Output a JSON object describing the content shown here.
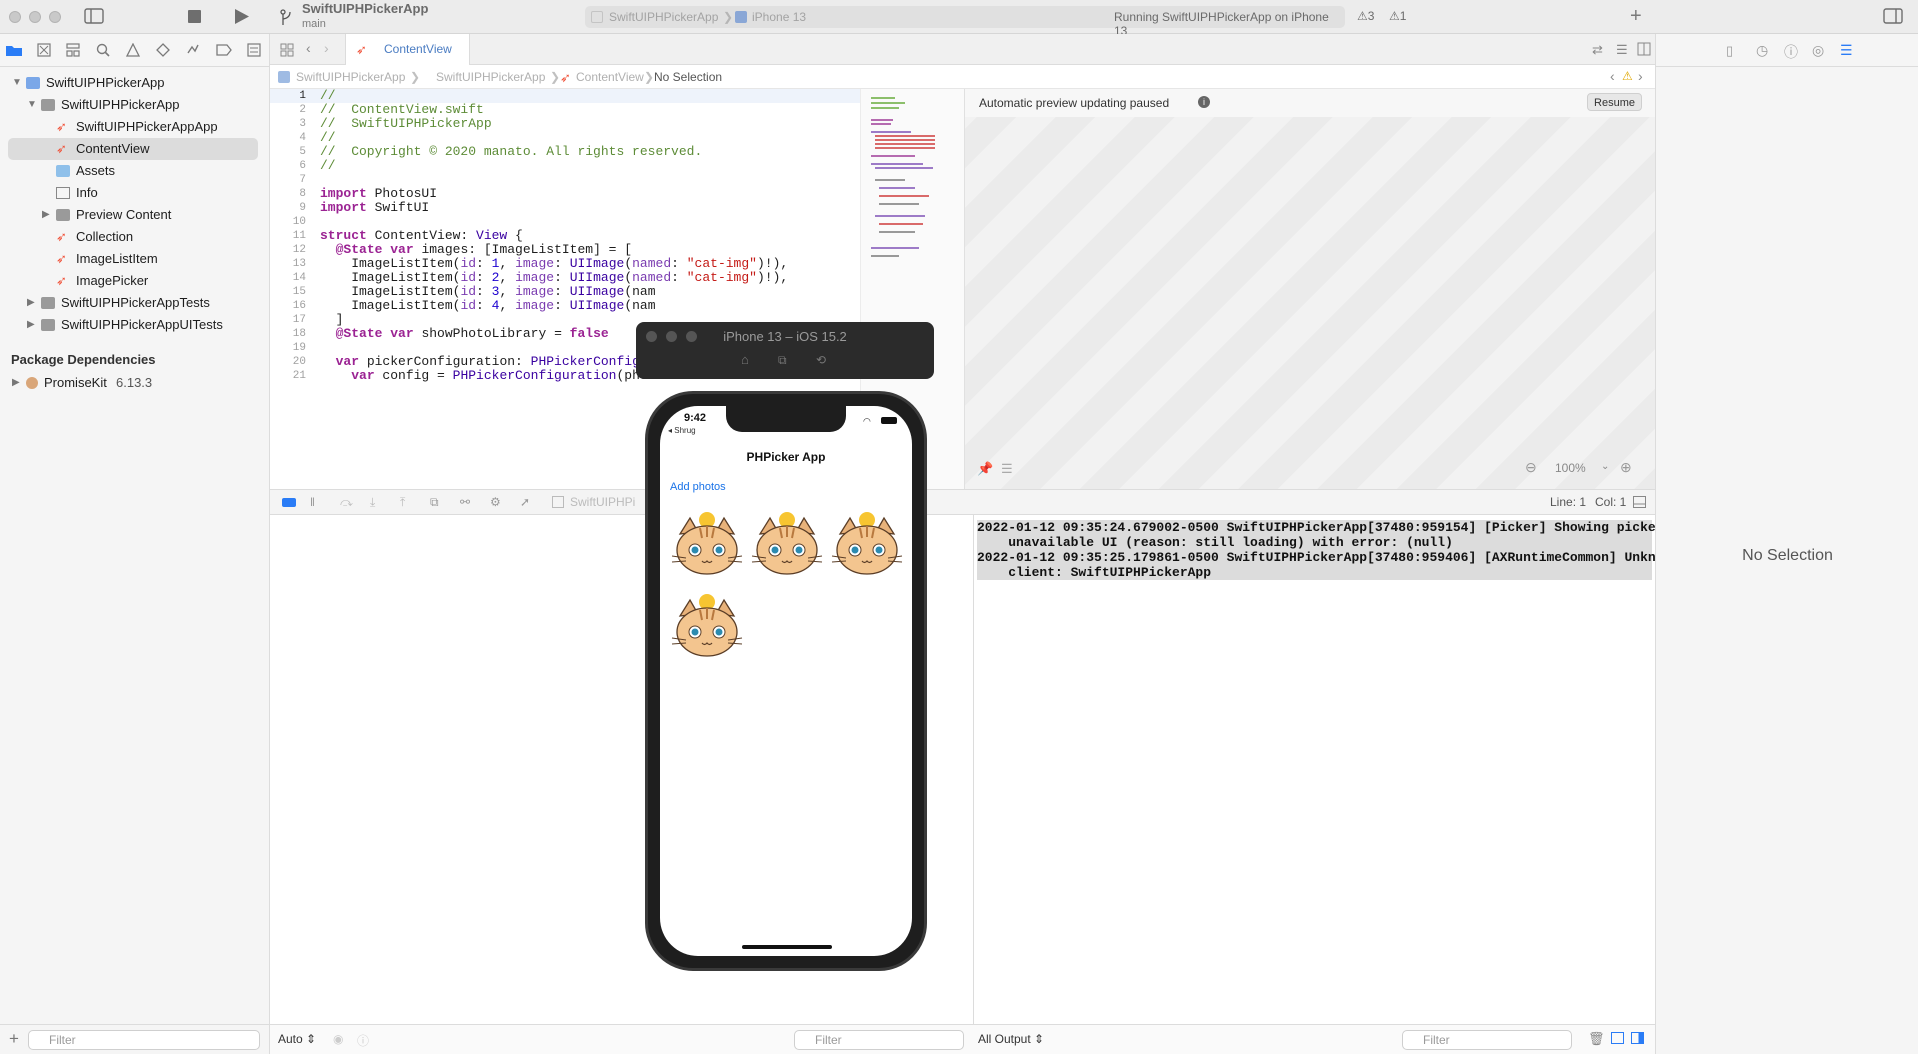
{
  "window": {
    "project_title": "SwiftUIPHPickerApp",
    "branch": "main",
    "scheme_name": "SwiftUIPHPickerApp",
    "scheme_device": "iPhone 13",
    "run_status": "Running SwiftUIPHPickerApp on iPhone 13",
    "warning_count": "3",
    "error_count": "1"
  },
  "navigator": {
    "items": [
      {
        "label": "SwiftUIPHPickerApp",
        "kind": "project",
        "depth": 0,
        "disclosure": "open"
      },
      {
        "label": "SwiftUIPHPickerApp",
        "kind": "folder",
        "depth": 1,
        "disclosure": "open"
      },
      {
        "label": "SwiftUIPHPickerAppApp",
        "kind": "swift",
        "depth": 2,
        "disclosure": ""
      },
      {
        "label": "ContentView",
        "kind": "swift",
        "depth": 2,
        "disclosure": "",
        "selected": true
      },
      {
        "label": "Assets",
        "kind": "assets",
        "depth": 2,
        "disclosure": ""
      },
      {
        "label": "Info",
        "kind": "plist",
        "depth": 2,
        "disclosure": ""
      },
      {
        "label": "Preview Content",
        "kind": "folder",
        "depth": 2,
        "disclosure": "closed"
      },
      {
        "label": "Collection",
        "kind": "swift",
        "depth": 2,
        "disclosure": ""
      },
      {
        "label": "ImageListItem",
        "kind": "swift",
        "depth": 2,
        "disclosure": ""
      },
      {
        "label": "ImagePicker",
        "kind": "swift",
        "depth": 2,
        "disclosure": ""
      },
      {
        "label": "SwiftUIPHPickerAppTests",
        "kind": "folder",
        "depth": 1,
        "disclosure": "closed"
      },
      {
        "label": "SwiftUIPHPickerAppUITests",
        "kind": "folder",
        "depth": 1,
        "disclosure": "closed"
      }
    ],
    "package_section_title": "Package Dependencies",
    "package": {
      "name": "PromiseKit",
      "version": "6.13.3"
    },
    "filter_placeholder": "Filter"
  },
  "editor": {
    "tab_label": "ContentView",
    "jumpbar": [
      "SwiftUIPHPickerApp",
      "SwiftUIPHPickerApp",
      "ContentView",
      "No Selection"
    ],
    "code_lines": [
      "//",
      "//  ContentView.swift",
      "//  SwiftUIPHPickerApp",
      "//",
      "//  Copyright © 2020 manato. All rights reserved.",
      "//",
      "",
      "import PhotosUI",
      "import SwiftUI",
      "",
      "struct ContentView: View {",
      "  @State var images: [ImageListItem] = [",
      "    ImageListItem(id: 1, image: UIImage(named: \"cat-img\")!),",
      "    ImageListItem(id: 2, image: UIImage(named: \"cat-img\")!),",
      "    ImageListItem(id: 3, image: UIImage(nam",
      "    ImageListItem(id: 4, image: UIImage(nam",
      "  ]",
      "  @State var showPhotoLibrary = false",
      "",
      "  var pickerConfiguration: PHPickerConfigura",
      "    var config = PHPickerConfiguration(photo"
    ]
  },
  "canvas": {
    "paused_message": "Automatic preview updating paused",
    "resume_label": "Resume",
    "zoom": "100%"
  },
  "debug": {
    "debugbar_target": "SwiftUIPHPi",
    "cursor_line": "Line: 1",
    "cursor_col": "Col: 1",
    "variables_mode": "Auto ⇕",
    "output_mode": "All Output ⇕",
    "filter_placeholder": "Filter",
    "console_lines": [
      "2022-01-12 09:35:24.679002-0500 SwiftUIPHPickerApp[37480:959154] [Picker] Showing picker\n    unavailable UI (reason: still loading) with error: (null)",
      "2022-01-12 09:35:25.179861-0500 SwiftUIPHPickerApp[37480:959406] [AXRuntimeCommon] Unknown\n    client: SwiftUIPHPickerApp"
    ]
  },
  "inspector": {
    "empty_label": "No Selection"
  },
  "simulator": {
    "title": "iPhone 13 – iOS 15.2",
    "status_time": "9:42",
    "back_app": "◂ Shrug",
    "nav_title": "PHPicker App",
    "add_button": "Add photos",
    "image_count": 4
  }
}
